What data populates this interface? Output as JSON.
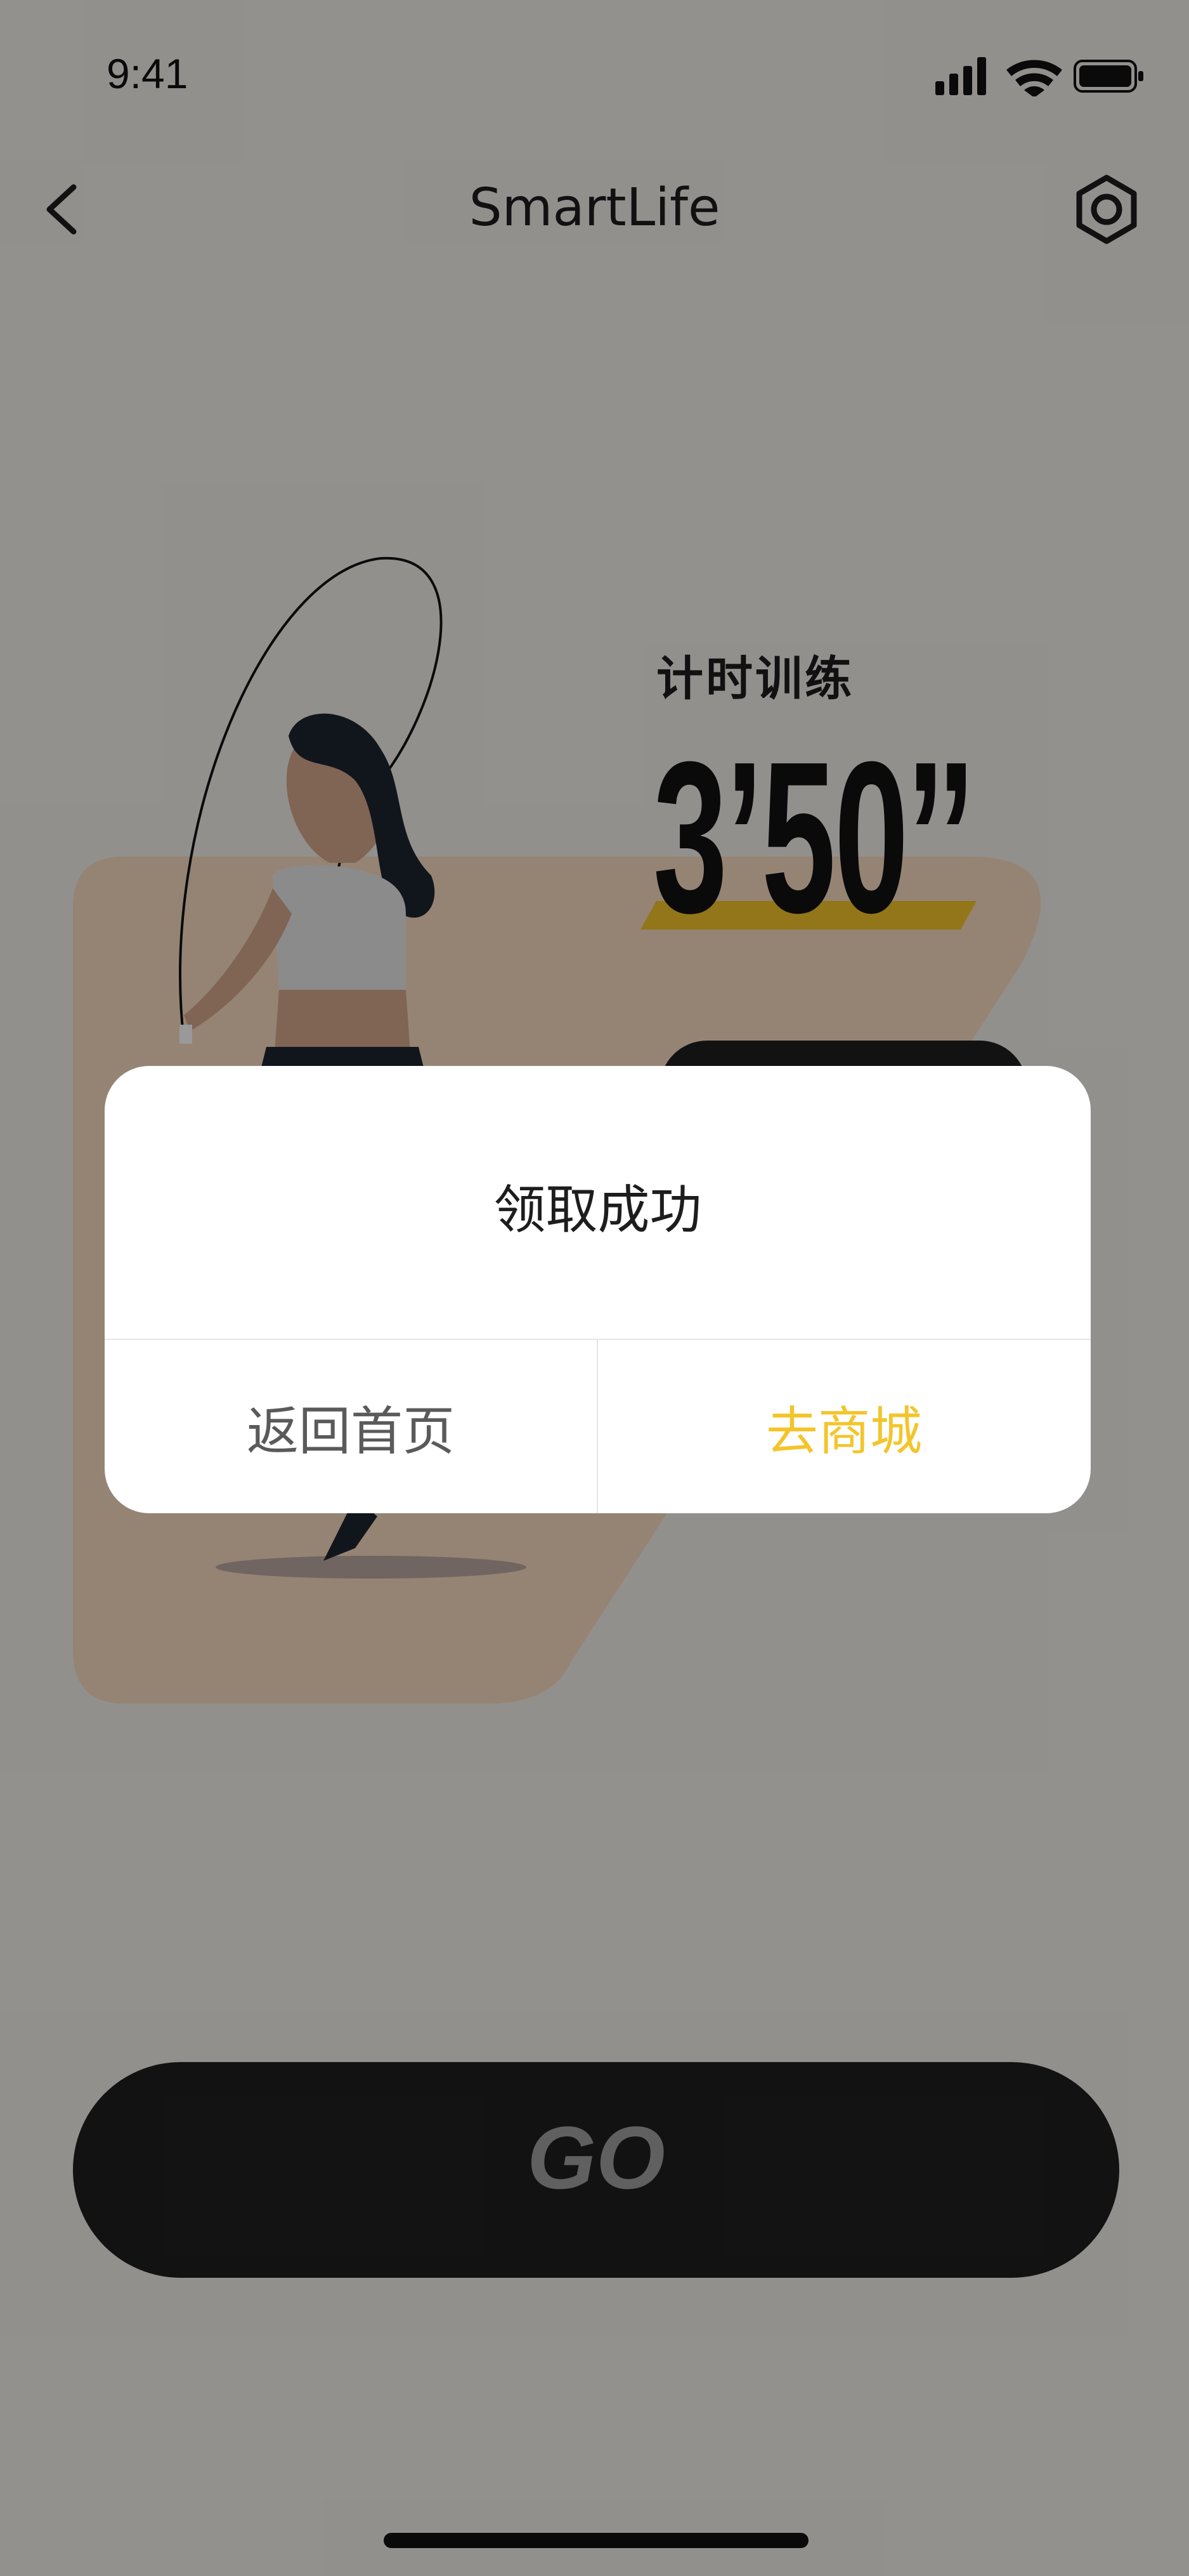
{
  "status_bar": {
    "time": "9:41",
    "icons": [
      "signal-icon",
      "wifi-icon",
      "battery-icon"
    ]
  },
  "nav": {
    "title": "SmartLife",
    "back_icon": "chevron-left-icon",
    "settings_icon": "hexagon-settings-icon"
  },
  "workout": {
    "label": "计时训练",
    "timer": "3’50’’"
  },
  "main_button": {
    "label": "GO"
  },
  "dialog": {
    "message": "领取成功",
    "left_button": "返回首页",
    "right_button": "去商城"
  },
  "colors": {
    "accent": "#f3c52b",
    "timer_underline": "#f3c52b",
    "card_bg": "#f8dcc2",
    "button_dark": "#1f1f1f"
  }
}
